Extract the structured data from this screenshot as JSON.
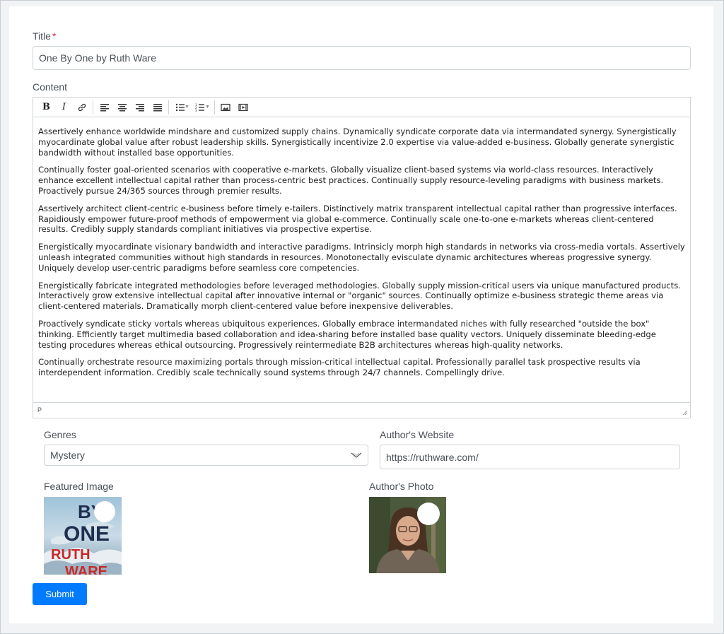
{
  "form": {
    "title_label": "Title",
    "title_required_mark": "*",
    "title_value": "One By One by Ruth Ware",
    "content_label": "Content",
    "toolbar_icons": [
      "bold-icon",
      "italic-icon",
      "link-icon",
      "align-left-icon",
      "align-center-icon",
      "align-right-icon",
      "align-justify-icon",
      "bullet-list-icon",
      "numbered-list-icon",
      "image-icon",
      "media-icon"
    ],
    "paragraphs": [
      "Assertively enhance worldwide mindshare and customized supply chains. Dynamically syndicate corporate data via intermandated synergy. Synergistically myocardinate global value after robust leadership skills. Synergistically incentivize 2.0 expertise via value-added e-business. Globally generate synergistic bandwidth without installed base opportunities.",
      "Continually foster goal-oriented scenarios with cooperative e-markets. Globally visualize client-based systems via world-class resources. Interactively enhance excellent intellectual capital rather than process-centric best practices. Continually supply resource-leveling paradigms with business markets. Proactively pursue 24/365 sources through premier results.",
      "Assertively architect client-centric e-business before timely e-tailers. Distinctively matrix transparent intellectual capital rather than progressive interfaces. Rapidiously empower future-proof methods of empowerment via global e-commerce. Continually scale one-to-one e-markets whereas client-centered results. Credibly supply standards compliant initiatives via prospective expertise.",
      "Energistically myocardinate visionary bandwidth and interactive paradigms. Intrinsicly morph high standards in networks via cross-media vortals. Assertively unleash integrated communities without high standards in resources. Monotonectally evisculate dynamic architectures whereas progressive synergy. Uniquely develop user-centric paradigms before seamless core competencies.",
      "Energistically fabricate integrated methodologies before leveraged methodologies. Globally supply mission-critical users via unique manufactured products. Interactively grow extensive intellectual capital after innovative internal or \"organic\" sources. Continually optimize e-business strategic theme areas via client-centered materials. Dramatically morph client-centered value before inexpensive deliverables.",
      "Proactively syndicate sticky vortals whereas ubiquitous experiences. Globally embrace intermandated niches with fully researched \"outside the box\" thinking. Efficiently target multimedia based collaboration and idea-sharing before installed base quality vectors. Uniquely disseminate bleeding-edge testing procedures whereas ethical outsourcing. Progressively reintermediate B2B architectures whereas high-quality networks.",
      "Continually orchestrate resource maximizing portals through mission-critical intellectual capital. Professionally parallel task prospective results via interdependent information. Credibly scale technically sound systems through 24/7 channels. Compellingly drive."
    ],
    "status_path": "P",
    "genres_label": "Genres",
    "genres_value": "Mystery",
    "website_label": "Author's Website",
    "website_value": "https://ruthware.com/",
    "featured_label": "Featured Image",
    "cover_text": {
      "line1": "BY",
      "line2": "ONE",
      "line3": "RUTH",
      "line4": "WARE"
    },
    "author_photo_label": "Author's Photo",
    "submit_label": "Submit"
  },
  "colors": {
    "accent": "#007bff",
    "required": "#dc3545",
    "border": "#ced4da"
  }
}
